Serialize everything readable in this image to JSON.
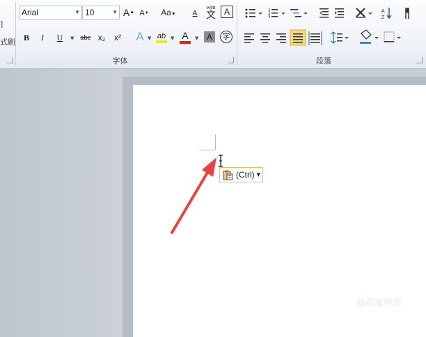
{
  "clipboard": {
    "partial_label_1": "]",
    "partial_label_2": "式刷"
  },
  "font_group": {
    "label": "字体",
    "font_name": "Arial",
    "font_size": "10",
    "buttons": {
      "grow": "A",
      "shrink": "A",
      "change_case": "Aa",
      "clear_format": "A",
      "phonetic": "wén",
      "phonetic_char": "文",
      "char_border": "A",
      "bold": "B",
      "italic": "I",
      "underline": "U",
      "strikethrough": "abc",
      "subscript": "x₂",
      "superscript": "x²",
      "text_effect": "A",
      "highlight": "ab",
      "font_color": "A",
      "char_shading": "A",
      "enclose": "字"
    }
  },
  "paragraph_group": {
    "label": "段落"
  },
  "paste_options": {
    "label": "(Ctrl)"
  },
  "watermark": "@百度经验",
  "colors": {
    "highlight": "#f5e500",
    "font_color": "#e2231a",
    "arrow": "#e84343",
    "active_align": "#fbd97b"
  }
}
